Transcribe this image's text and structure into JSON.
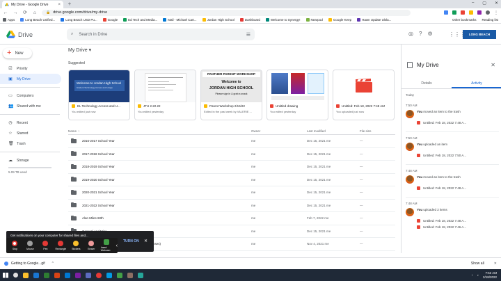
{
  "browser": {
    "tab_title": "My Drive - Google Drive",
    "tab_close": "×",
    "new_tab": "+",
    "window_controls": [
      "–",
      "▢",
      "✕"
    ],
    "back": "←",
    "forward": "→",
    "reload": "⟳",
    "home": "⌂",
    "url": "drive.google.com/drive/my-drive",
    "bookmarks": [
      {
        "label": "Apps",
        "color": "#5f6368"
      },
      {
        "label": "Long Beach Unified...",
        "color": "#4285f4"
      },
      {
        "label": "Long Beach USD Pu...",
        "color": "#1a73e8"
      },
      {
        "label": "Google",
        "color": "#ea4335"
      },
      {
        "label": "Ed Tech and Media...",
        "color": "#0f9d58"
      },
      {
        "label": "Mail - Michael Cart...",
        "color": "#0078d4"
      },
      {
        "label": "Jordan High School",
        "color": "#fbbc04"
      },
      {
        "label": "Dashboard",
        "color": "#e53935"
      },
      {
        "label": "Welcome to Synergy!",
        "color": "#00897b"
      },
      {
        "label": "Nearpod",
        "color": "#7cb342"
      },
      {
        "label": "Google Keep",
        "color": "#fbbc04"
      },
      {
        "label": "Hawn Update Ulsla...",
        "color": "#5e35b1"
      }
    ],
    "bookmarks_right": [
      "Other bookmarks",
      "Reading list"
    ]
  },
  "drive_header": {
    "product": "Drive",
    "search_placeholder": "Search in Drive",
    "search_icon": "⌕",
    "tune_icon": "☰",
    "help_icon": "?",
    "settings_icon": "⚙",
    "apps_icon": "⋮⋮⋮",
    "org_label": "LONG BEACH"
  },
  "sidebar": {
    "new_label": "New",
    "new_plus": "+",
    "items": [
      {
        "label": "Priority",
        "icon": "☑",
        "active": false
      },
      {
        "label": "My Drive",
        "icon": "▣",
        "active": true
      },
      {
        "label": "Computers",
        "icon": "▭",
        "active": false
      },
      {
        "label": "Shared with me",
        "icon": "👥",
        "active": false
      },
      {
        "label": "Recent",
        "icon": "◷",
        "active": false
      },
      {
        "label": "Starred",
        "icon": "☆",
        "active": false
      },
      {
        "label": "Trash",
        "icon": "🗑",
        "active": false
      }
    ],
    "storage_label": "Storage",
    "storage_icon": "☁",
    "storage_used": "5.09 TB used"
  },
  "main": {
    "title": "My Drive",
    "title_caret": "▾",
    "suggested_label": "Suggested",
    "cards": [
      {
        "name": "EL Technology Access and U...",
        "sub": "You edited just now",
        "color": "#fbbc04"
      },
      {
        "name": "JTU 2.22.22",
        "sub": "You edited yesterday",
        "color": "#fbbc04"
      },
      {
        "name": "Parent Workshop 2/15/22",
        "sub": "Edited in the past week by VALERIE ...",
        "color": "#fbbc04"
      },
      {
        "name": "Untitled drawing",
        "sub": "You edited yesterday",
        "color": "#ea4335"
      },
      {
        "name": "Untitled: Feb 18, 2022 7:48 AM",
        "sub": "You uploaded just now",
        "color": "#ea4335"
      }
    ],
    "card1_thumb": {
      "title": "Welcome to Jordan High School",
      "sub": "Student Technology Access and Usage"
    },
    "card3_thumb": {
      "banner": "PANTHER PARENT WORKSHOP",
      "line1": "Welcome to",
      "line2": "JORDAN HIGH SCHOOL",
      "line3": "Please sign in & grab a snack"
    },
    "columns": {
      "name": "Name",
      "sort_arrow": "↑",
      "owner": "Owner",
      "modified": "Last modified",
      "size": "File size"
    },
    "rows": [
      {
        "name": "2016-2017 School Year",
        "owner": "me",
        "modified": "Dec 15, 2021 me",
        "size": "—"
      },
      {
        "name": "2017-2018 School Year",
        "owner": "me",
        "modified": "Dec 15, 2021 me",
        "size": "—"
      },
      {
        "name": "2018-2019 School Year",
        "owner": "me",
        "modified": "Dec 15, 2021 me",
        "size": "—"
      },
      {
        "name": "2019-2020 School Year",
        "owner": "me",
        "modified": "Dec 15, 2021 me",
        "size": "—"
      },
      {
        "name": "2020-2021 School Year",
        "owner": "me",
        "modified": "Dec 15, 2021 me",
        "size": "—"
      },
      {
        "name": "2021-2022 School Year",
        "owner": "me",
        "modified": "Dec 15, 2021 me",
        "size": "—"
      },
      {
        "name": "Alan Miles 60th",
        "owner": "me",
        "modified": "Feb 7, 2022 me",
        "size": "—"
      },
      {
        "name": "General and Misc",
        "owner": "me",
        "modified": "Dec 15, 2021 me",
        "size": "—"
      },
      {
        "name": "Teacher Nominations - September 2021 (File responses)",
        "owner": "me",
        "modified": "Nov 4, 2021 me",
        "size": "—"
      }
    ]
  },
  "details": {
    "title": "My Drive",
    "close": "✕",
    "tab_details": "Details",
    "tab_activity": "Activity",
    "today": "Today",
    "activities": [
      {
        "time": "7:50 AM",
        "actor": "You",
        "action": " moved an item to the trash",
        "file": "Untitled: Feb 18, 2022 7:48 A..."
      },
      {
        "time": "7:50 AM",
        "actor": "You",
        "action": " uploaded an item",
        "file": "Untitled: Feb 18, 2022 7:50 A..."
      },
      {
        "time": "7:48 AM",
        "actor": "You",
        "action": " moved an item to the trash",
        "file": "Untitled: Feb 18, 2022 7:48 A..."
      },
      {
        "time": "7:48 AM",
        "actor": "You",
        "action": " uploaded 2 items",
        "file": "Untitled: Feb 18, 2022 7:48 A...",
        "file2": "Untitled: Feb 18, 2022 7:46 A..."
      }
    ]
  },
  "zoom": {
    "notification": "Get notifications on your computer for shared files and...",
    "turn_on": "TURN ON",
    "close": "✕",
    "controls": [
      "Stop",
      "Mouse",
      "Pen",
      "Rectangle",
      "Stickers",
      "Eraser",
      "Insert Webcam"
    ],
    "collapse": "‹"
  },
  "downloads": {
    "file": "Getting to Google...gif",
    "chevron": "^",
    "show_all": "Show all",
    "close": "✕"
  },
  "taskbar": {
    "time": "7:52 AM",
    "date": "2/18/2022"
  }
}
